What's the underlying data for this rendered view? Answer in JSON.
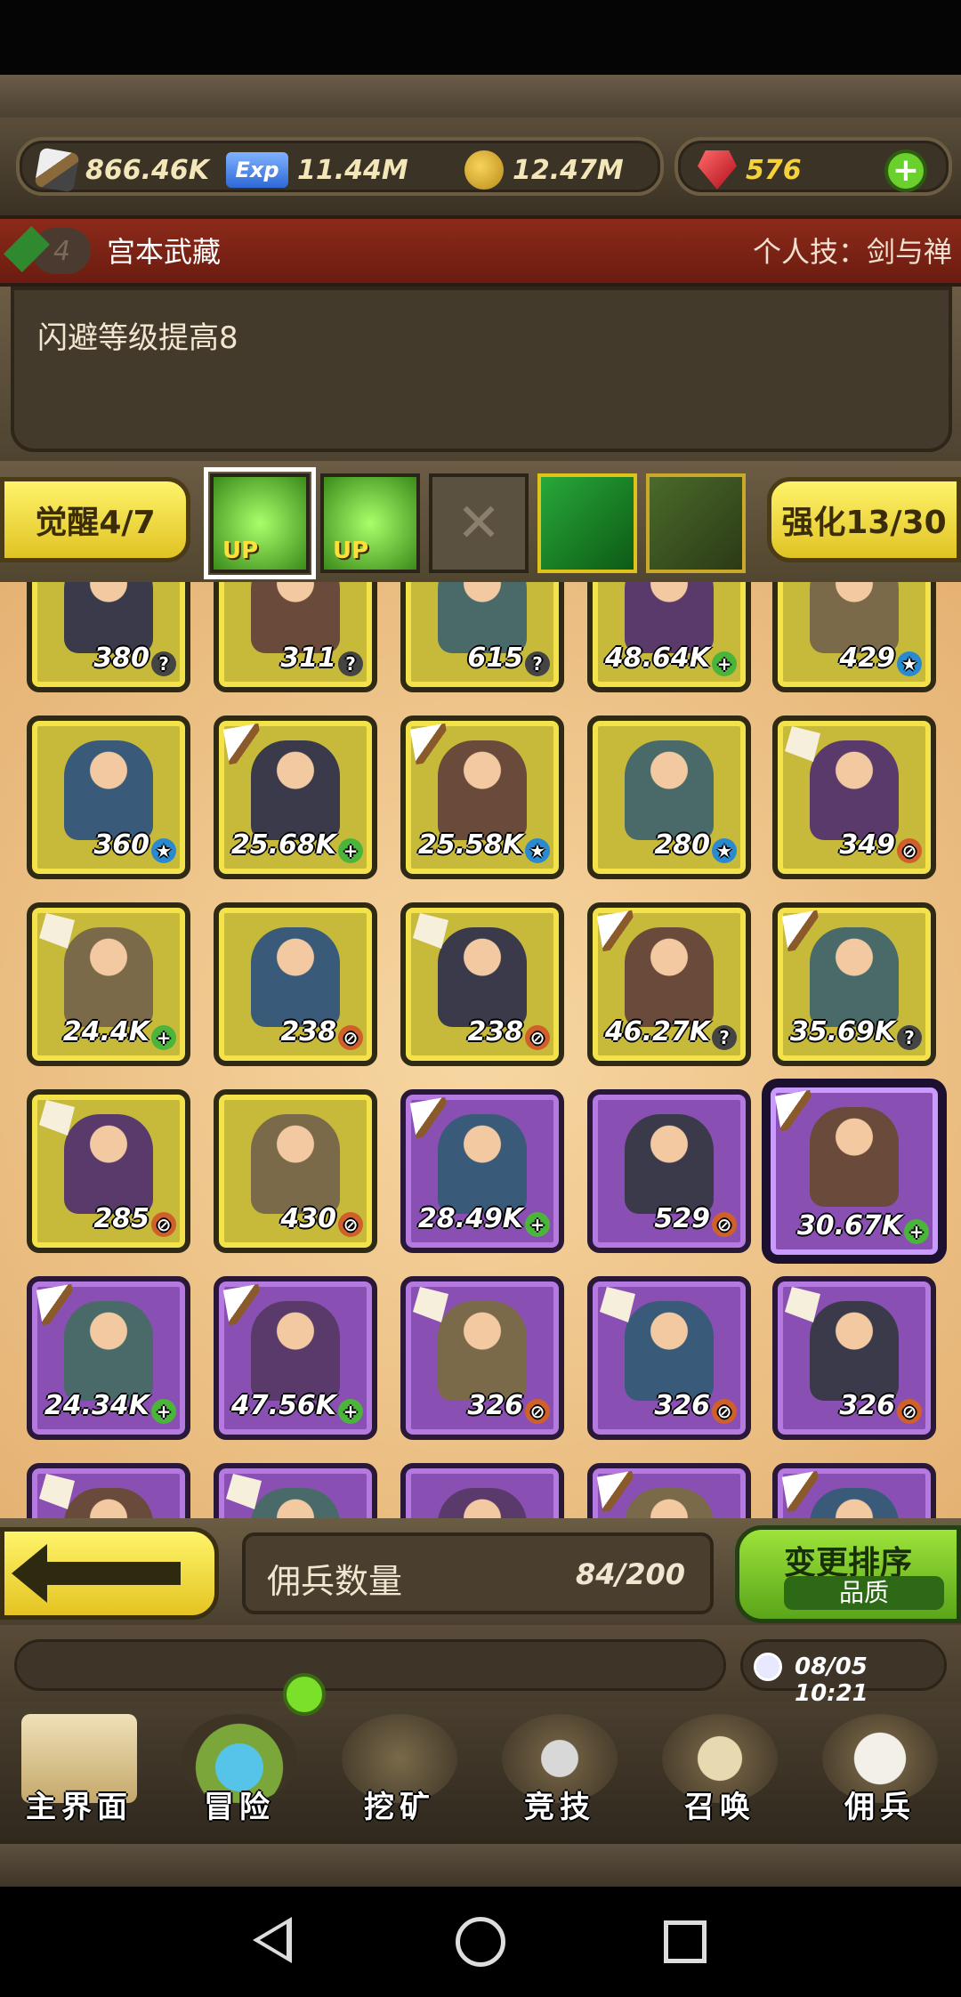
{
  "status_bar": {},
  "resources": {
    "attack": "866.46K",
    "exp_label": "Exp",
    "exp": "11.44M",
    "gold": "12.47M",
    "gems": "576",
    "add_label": "+"
  },
  "hero": {
    "level": "4",
    "name": "宫本武藏",
    "skill_label": "个人技：剑与禅",
    "description": "闪避等级提高8"
  },
  "skills_row": {
    "awaken_label": "觉醒4/7",
    "enhance_label": "强化13/30",
    "slot_up_label": "UP",
    "empty_slot_label": "✕"
  },
  "grid": {
    "rows": [
      [
        {
          "value": "380",
          "badge": "?",
          "color": "gold",
          "tag": ""
        },
        {
          "value": "311",
          "badge": "?",
          "color": "gold",
          "tag": ""
        },
        {
          "value": "615",
          "badge": "?",
          "color": "gold",
          "tag": ""
        },
        {
          "value": "48.64K",
          "badge": "+",
          "color": "gold",
          "tag": ""
        },
        {
          "value": "429",
          "badge": "★",
          "color": "gold",
          "tag": ""
        }
      ],
      [
        {
          "value": "360",
          "badge": "★",
          "color": "gold",
          "tag": ""
        },
        {
          "value": "25.68K",
          "badge": "+",
          "color": "gold",
          "tag": "sword"
        },
        {
          "value": "25.58K",
          "badge": "★",
          "color": "gold",
          "tag": "sword"
        },
        {
          "value": "280",
          "badge": "★",
          "color": "gold",
          "tag": ""
        },
        {
          "value": "349",
          "badge": "⊘",
          "color": "gold",
          "tag": "shield"
        }
      ],
      [
        {
          "value": "24.4K",
          "badge": "+",
          "color": "gold",
          "tag": "shield"
        },
        {
          "value": "238",
          "badge": "⊘",
          "color": "gold",
          "tag": ""
        },
        {
          "value": "238",
          "badge": "⊘",
          "color": "gold",
          "tag": "shield"
        },
        {
          "value": "46.27K",
          "badge": "?",
          "color": "gold",
          "tag": "sword"
        },
        {
          "value": "35.69K",
          "badge": "?",
          "color": "gold",
          "tag": "sword"
        }
      ],
      [
        {
          "value": "285",
          "badge": "⊘",
          "color": "gold",
          "tag": "shield"
        },
        {
          "value": "430",
          "badge": "⊘",
          "color": "gold",
          "tag": ""
        },
        {
          "value": "28.49K",
          "badge": "+",
          "color": "purple",
          "tag": "sword"
        },
        {
          "value": "529",
          "badge": "⊘",
          "color": "purple",
          "tag": ""
        },
        {
          "value": "30.67K",
          "badge": "+",
          "color": "purple",
          "tag": "sword",
          "selected": true
        }
      ],
      [
        {
          "value": "24.34K",
          "badge": "+",
          "color": "purple",
          "tag": "sword"
        },
        {
          "value": "47.56K",
          "badge": "+",
          "color": "purple",
          "tag": "sword"
        },
        {
          "value": "326",
          "badge": "⊘",
          "color": "purple",
          "tag": "shield"
        },
        {
          "value": "326",
          "badge": "⊘",
          "color": "purple",
          "tag": "shield"
        },
        {
          "value": "326",
          "badge": "⊘",
          "color": "purple",
          "tag": "shield"
        }
      ],
      [
        {
          "value": "",
          "badge": "",
          "color": "purple",
          "tag": "shield"
        },
        {
          "value": "",
          "badge": "",
          "color": "purple",
          "tag": "shield"
        },
        {
          "value": "",
          "badge": "",
          "color": "purple",
          "tag": ""
        },
        {
          "value": "",
          "badge": "",
          "color": "purple",
          "tag": "sword"
        },
        {
          "value": "",
          "badge": "",
          "color": "purple",
          "tag": "sword"
        }
      ]
    ]
  },
  "controls": {
    "count_label": "佣兵数量",
    "count_value": "84/200",
    "sort_title": "变更排序",
    "sort_sub": "品质"
  },
  "messages": {
    "time": "08/05 10:21"
  },
  "nav": {
    "items": [
      {
        "label": "主界面",
        "icon": "map-icon"
      },
      {
        "label": "冒险",
        "icon": "island-icon"
      },
      {
        "label": "挖矿",
        "icon": "pickaxe-icon"
      },
      {
        "label": "竞技",
        "icon": "crossed-swords-icon"
      },
      {
        "label": "召唤",
        "icon": "scroll-icon"
      },
      {
        "label": "佣兵",
        "icon": "tent-icon"
      }
    ]
  },
  "colors": {
    "gold_card": "#c7b93a",
    "purple_card": "#8a4fb3",
    "banner": "#8c2a1a",
    "accent_green": "#9de33a"
  }
}
